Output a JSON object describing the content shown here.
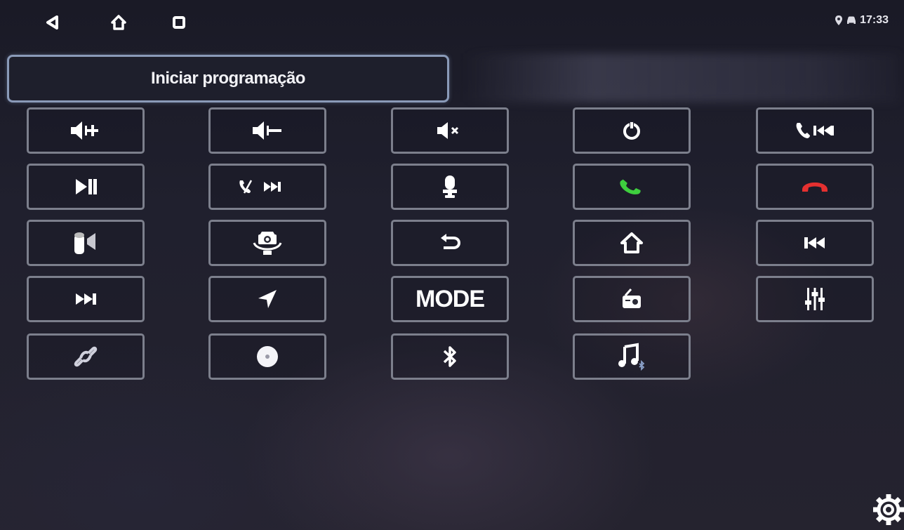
{
  "status_bar": {
    "time": "17:33",
    "icons": [
      "location-icon",
      "car-icon"
    ]
  },
  "nav": {
    "back": "back-triangle-icon",
    "home": "home-icon",
    "recent": "recent-apps-icon"
  },
  "header": {
    "program_label": "Iniciar programação"
  },
  "keys": [
    {
      "icon": "volume-up-icon"
    },
    {
      "icon": "volume-down-icon"
    },
    {
      "icon": "mute-icon"
    },
    {
      "icon": "power-icon"
    },
    {
      "icon": "phone-prev-icon"
    },
    {
      "icon": "play-pause-icon"
    },
    {
      "icon": "phone-next-icon"
    },
    {
      "icon": "voice-icon"
    },
    {
      "icon": "answer-call-icon",
      "color": "#3ecf3e"
    },
    {
      "icon": "hang-up-icon",
      "color": "#e53030"
    },
    {
      "icon": "speaker-icon"
    },
    {
      "icon": "camera-360-icon"
    },
    {
      "icon": "return-icon"
    },
    {
      "icon": "home-icon"
    },
    {
      "icon": "previous-track-icon"
    },
    {
      "icon": "next-track-icon"
    },
    {
      "icon": "navigation-icon"
    },
    {
      "label": "MODE"
    },
    {
      "icon": "radio-icon"
    },
    {
      "icon": "equalizer-icon"
    },
    {
      "icon": "link-icon"
    },
    {
      "icon": "disc-icon"
    },
    {
      "icon": "bluetooth-icon"
    },
    {
      "icon": "bluetooth-music-icon"
    }
  ],
  "settings": {
    "icon": "gear-icon"
  }
}
